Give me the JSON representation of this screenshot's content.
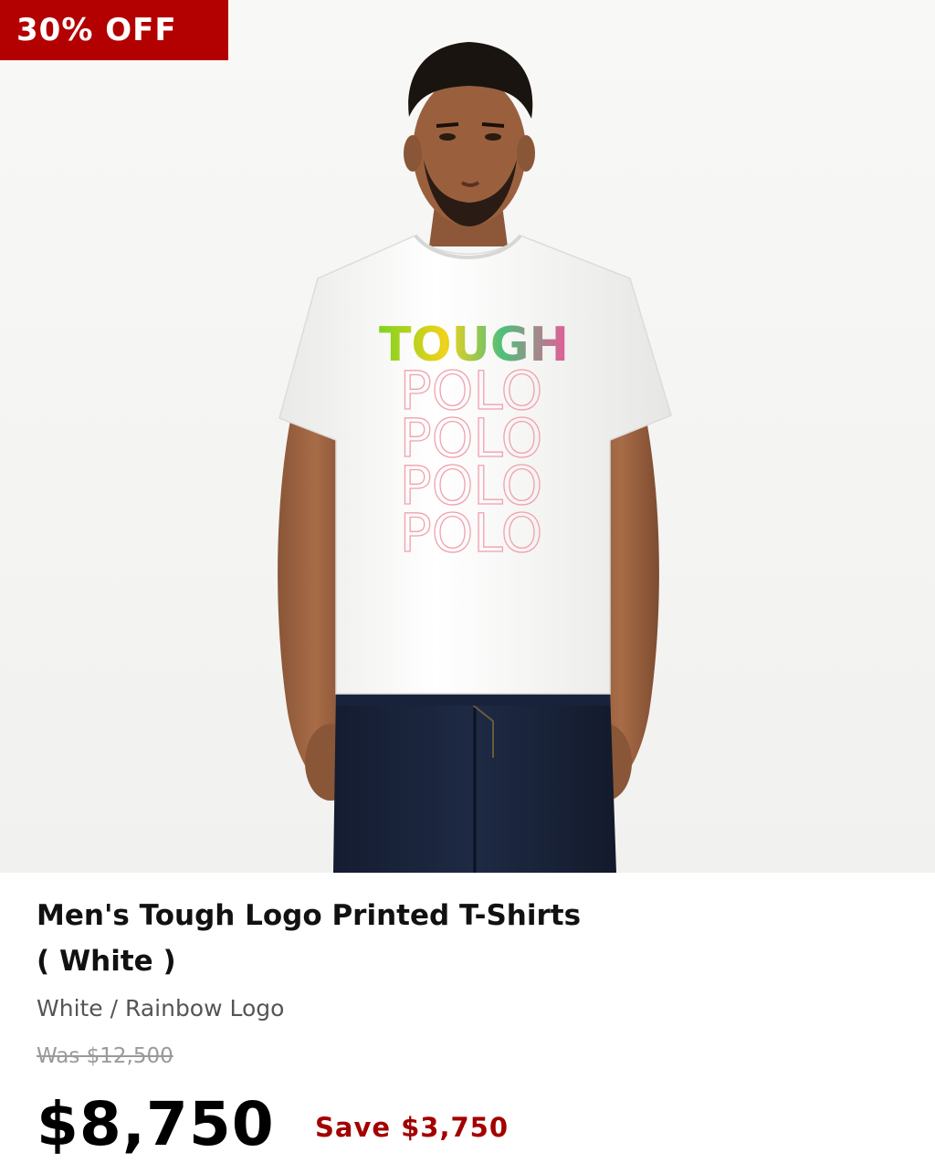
{
  "badge": {
    "label": "30% OFF"
  },
  "product": {
    "image_alt": "Man wearing white t-shirt with Tough Polo rainbow logo",
    "shirt_print": {
      "headline": "TOUGH",
      "repeat": [
        "POLO",
        "POLO",
        "POLO",
        "POLO"
      ]
    },
    "title_line1": "Men's Tough Logo Printed T-Shirts",
    "title_line2": "( White )",
    "variant": "White / Rainbow Logo"
  },
  "pricing": {
    "was": "Was $12,500",
    "current": "$8,750",
    "save": "Save $3,750"
  },
  "colors": {
    "badge_bg": "#b30000",
    "save_text": "#a30000",
    "was_text": "#9a9a9a"
  }
}
